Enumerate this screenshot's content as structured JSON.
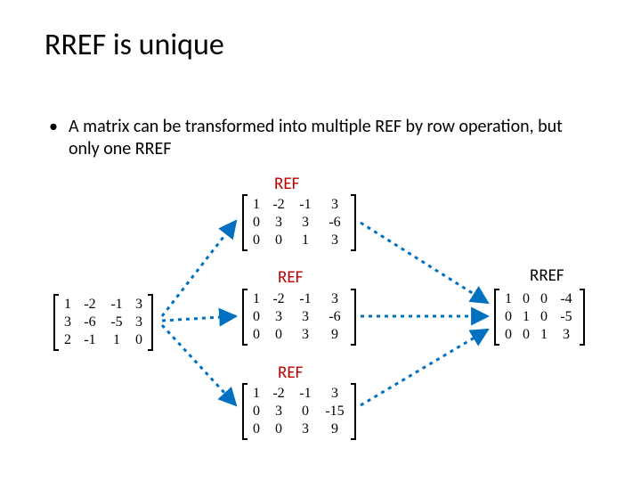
{
  "title": "RREF is unique",
  "bullet": "A matrix can be transformed into multiple REF by row operation, but only one RREF",
  "labels": {
    "ref1": "REF",
    "ref2": "REF",
    "ref3": "REF",
    "rref": "RREF"
  },
  "matrices": {
    "source": [
      [
        "1",
        "-2",
        "-1",
        "3"
      ],
      [
        "3",
        "-6",
        "-5",
        "3"
      ],
      [
        "2",
        "-1",
        "1",
        "0"
      ]
    ],
    "ref_top": [
      [
        "1",
        "-2",
        "-1",
        "3"
      ],
      [
        "0",
        "3",
        "3",
        "-6"
      ],
      [
        "0",
        "0",
        "1",
        "3"
      ]
    ],
    "ref_mid": [
      [
        "1",
        "-2",
        "-1",
        "3"
      ],
      [
        "0",
        "3",
        "3",
        "-6"
      ],
      [
        "0",
        "0",
        "3",
        "9"
      ]
    ],
    "ref_bot": [
      [
        "1",
        "-2",
        "-1",
        "3"
      ],
      [
        "0",
        "3",
        "0",
        "-15"
      ],
      [
        "0",
        "0",
        "3",
        "9"
      ]
    ],
    "rref": [
      [
        "1",
        "0",
        "0",
        "-4"
      ],
      [
        "0",
        "1",
        "0",
        "-5"
      ],
      [
        "0",
        "0",
        "1",
        "3"
      ]
    ]
  },
  "arrow_color": "#0070c0"
}
